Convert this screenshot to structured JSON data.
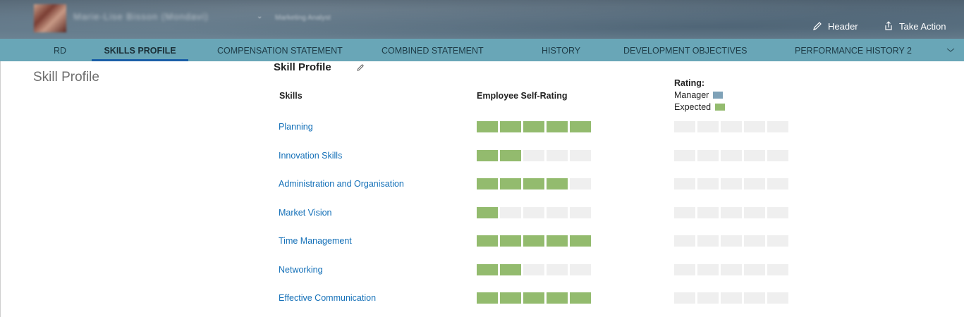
{
  "header": {
    "user_name": "Marie-Lise Bisson (Mondavi)",
    "user_role": "Marketing Analyst",
    "actions": [
      {
        "label": "Header",
        "icon": "pencil-icon"
      },
      {
        "label": "Take Action",
        "icon": "share-icon"
      }
    ]
  },
  "tabs": [
    {
      "label": "RD",
      "active": false
    },
    {
      "label": "SKILLS PROFILE",
      "active": true
    },
    {
      "label": "COMPENSATION STATEMENT",
      "active": false
    },
    {
      "label": "COMBINED STATEMENT",
      "active": false
    },
    {
      "label": "HISTORY",
      "active": false
    },
    {
      "label": "DEVELOPMENT OBJECTIVES",
      "active": false
    },
    {
      "label": "PERFORMANCE HISTORY 2",
      "active": false
    }
  ],
  "section": {
    "title": "Skill Profile"
  },
  "panel": {
    "title": "Skill Profile",
    "columns": {
      "skills": "Skills",
      "self_rating": "Employee Self-Rating"
    },
    "legend": {
      "title": "Rating:",
      "items": [
        {
          "label": "Manager",
          "color": "#7fa2b8"
        },
        {
          "label": "Expected",
          "color": "#93bb6e"
        }
      ]
    },
    "max_rating": 5,
    "colors": {
      "filled": "#93bb6e",
      "empty": "#efefef"
    },
    "skills": [
      {
        "name": "Planning",
        "self_rating": 5,
        "manager_rating": 0
      },
      {
        "name": "Innovation Skills",
        "self_rating": 2,
        "manager_rating": 0
      },
      {
        "name": "Administration and Organisation",
        "self_rating": 4,
        "manager_rating": 0
      },
      {
        "name": "Market Vision",
        "self_rating": 1,
        "manager_rating": 0
      },
      {
        "name": "Time Management",
        "self_rating": 5,
        "manager_rating": 0
      },
      {
        "name": "Networking",
        "self_rating": 2,
        "manager_rating": 0
      },
      {
        "name": "Effective Communication",
        "self_rating": 5,
        "manager_rating": 0
      }
    ]
  }
}
